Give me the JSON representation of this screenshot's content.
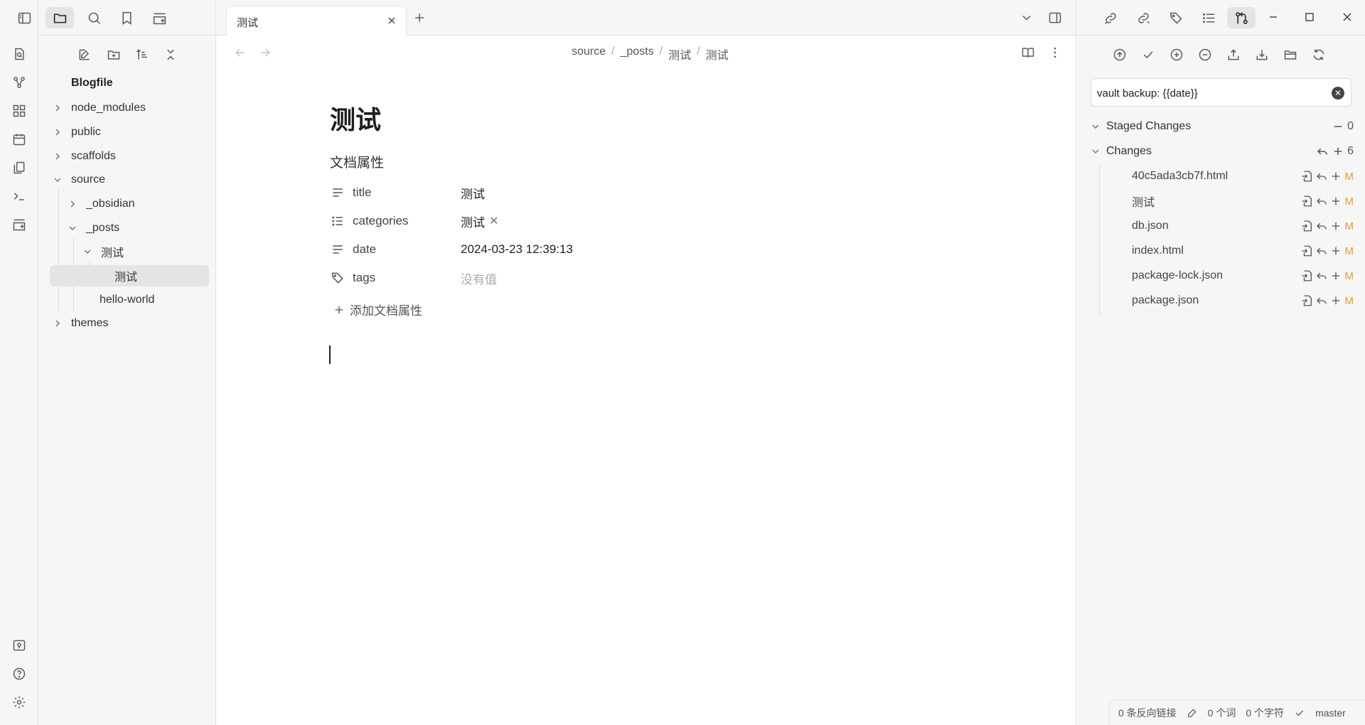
{
  "file_explorer": {
    "vault_name": "Blogfile",
    "items": [
      {
        "label": "node_modules"
      },
      {
        "label": "public"
      },
      {
        "label": "scaffolds"
      },
      {
        "label": "source"
      },
      {
        "label": "_obsidian"
      },
      {
        "label": "_posts"
      },
      {
        "label": "测试"
      },
      {
        "label": "测试"
      },
      {
        "label": "hello-world"
      },
      {
        "label": "themes"
      }
    ]
  },
  "tab": {
    "title": "测试"
  },
  "breadcrumb": {
    "items": [
      "source",
      "_posts",
      "测试",
      "测试"
    ],
    "separator": "/"
  },
  "note": {
    "title": "测试",
    "properties_heading": "文档属性",
    "properties": [
      {
        "key": "title",
        "value": "测试",
        "icon": "text-lines-icon"
      },
      {
        "key": "categories",
        "value": "测试",
        "icon": "list-icon"
      },
      {
        "key": "date",
        "value": "2024-03-23 12:39:13",
        "icon": "text-lines-icon"
      },
      {
        "key": "tags",
        "value": "没有值",
        "icon": "tags-icon"
      }
    ],
    "add_property": "添加文档属性"
  },
  "git": {
    "commit_message": "vault backup: {{date}}",
    "staged": {
      "label": "Staged Changes",
      "count": "0"
    },
    "changes": {
      "label": "Changes",
      "count": "6"
    },
    "files": [
      {
        "name": "40c5ada3cb7f.html",
        "status": "M"
      },
      {
        "name": "测试",
        "status": "M"
      },
      {
        "name": "db.json",
        "status": "M"
      },
      {
        "name": "index.html",
        "status": "M"
      },
      {
        "name": "package-lock.json",
        "status": "M"
      },
      {
        "name": "package.json",
        "status": "M"
      }
    ]
  },
  "status_bar": {
    "backlinks": "0 条反向链接",
    "words": "0 个词",
    "chars": "0 个字符",
    "branch": "master"
  },
  "colors": {
    "accent_status_modified": "#e69a3a",
    "sidebar_bg": "#f6f6f6",
    "selected_bg": "#e4e4e4"
  }
}
